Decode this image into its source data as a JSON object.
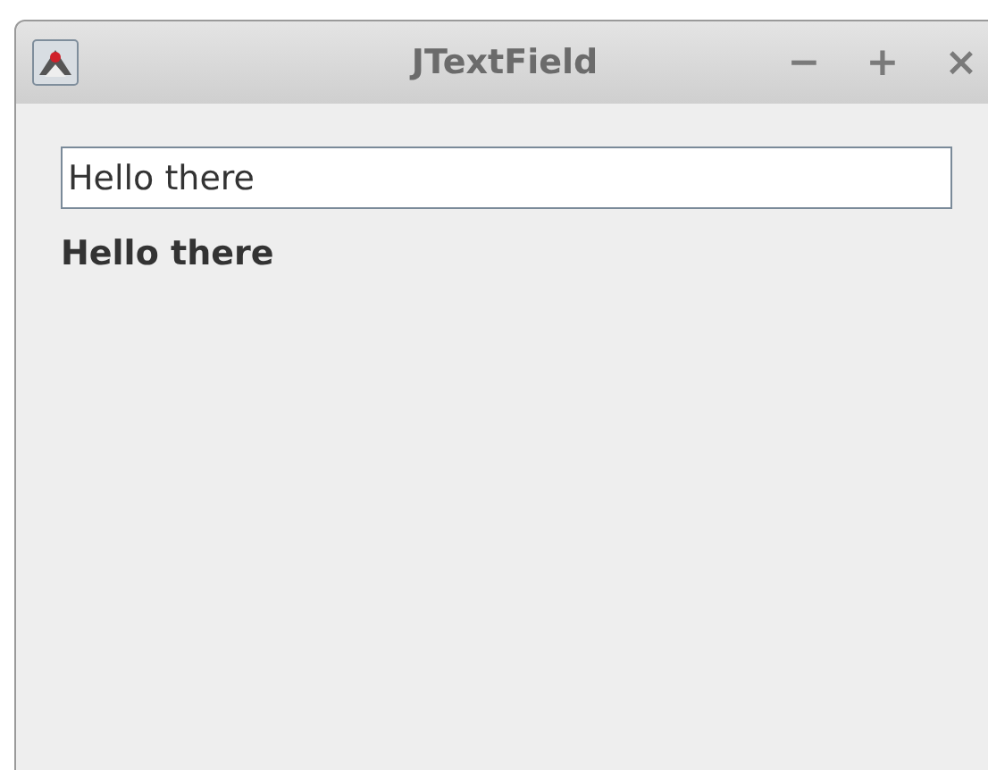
{
  "window": {
    "title": "JTextField",
    "controls": [
      "−",
      "+",
      "×"
    ]
  },
  "text_field": {
    "value": "Hello there"
  },
  "label": "Hello there"
}
